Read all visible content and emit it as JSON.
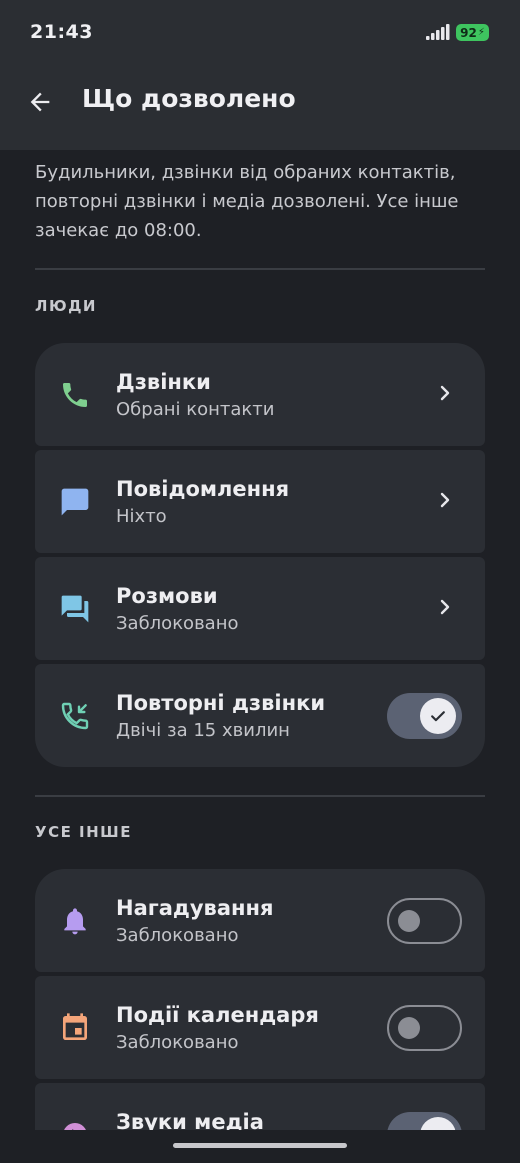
{
  "status_bar": {
    "time": "21:43",
    "battery": "92"
  },
  "app_bar": {
    "title": "Що дозволено"
  },
  "description": "Будильники, дзвінки від обраних контактів, повторні дзвінки і медіа дозволені. Усе інше зачекає до 08:00.",
  "sections": {
    "people": {
      "label": "ЛЮДИ",
      "items": [
        {
          "title": "Дзвінки",
          "subtitle": "Обрані контакти",
          "icon": "phone-icon",
          "color": "#7fcf8f"
        },
        {
          "title": "Повідомлення",
          "subtitle": "Ніхто",
          "icon": "message-icon",
          "color": "#8fb4f0"
        },
        {
          "title": "Розмови",
          "subtitle": "Заблоковано",
          "icon": "conversation-icon",
          "color": "#7fc6e6"
        },
        {
          "title": "Повторні дзвінки",
          "subtitle": "Двічі за 15 хвилин",
          "icon": "phone-missed-icon",
          "color": "#6fd0b4",
          "toggle": true
        }
      ]
    },
    "other": {
      "label": "УСЕ ІНШЕ",
      "items": [
        {
          "title": "Нагадування",
          "subtitle": "Заблоковано",
          "icon": "bell-icon",
          "color": "#b69cf0",
          "toggle": false
        },
        {
          "title": "Події календаря",
          "subtitle": "Заблоковано",
          "icon": "calendar-icon",
          "color": "#f4a57a",
          "toggle": false
        },
        {
          "title": "Звуки медіа",
          "subtitle": "",
          "icon": "media-icon",
          "color": "#d08fd6",
          "toggle": true
        }
      ]
    }
  },
  "colors": {
    "background": "#1e2025",
    "card": "#2b2e34",
    "toggle_on": "#5b6273"
  }
}
